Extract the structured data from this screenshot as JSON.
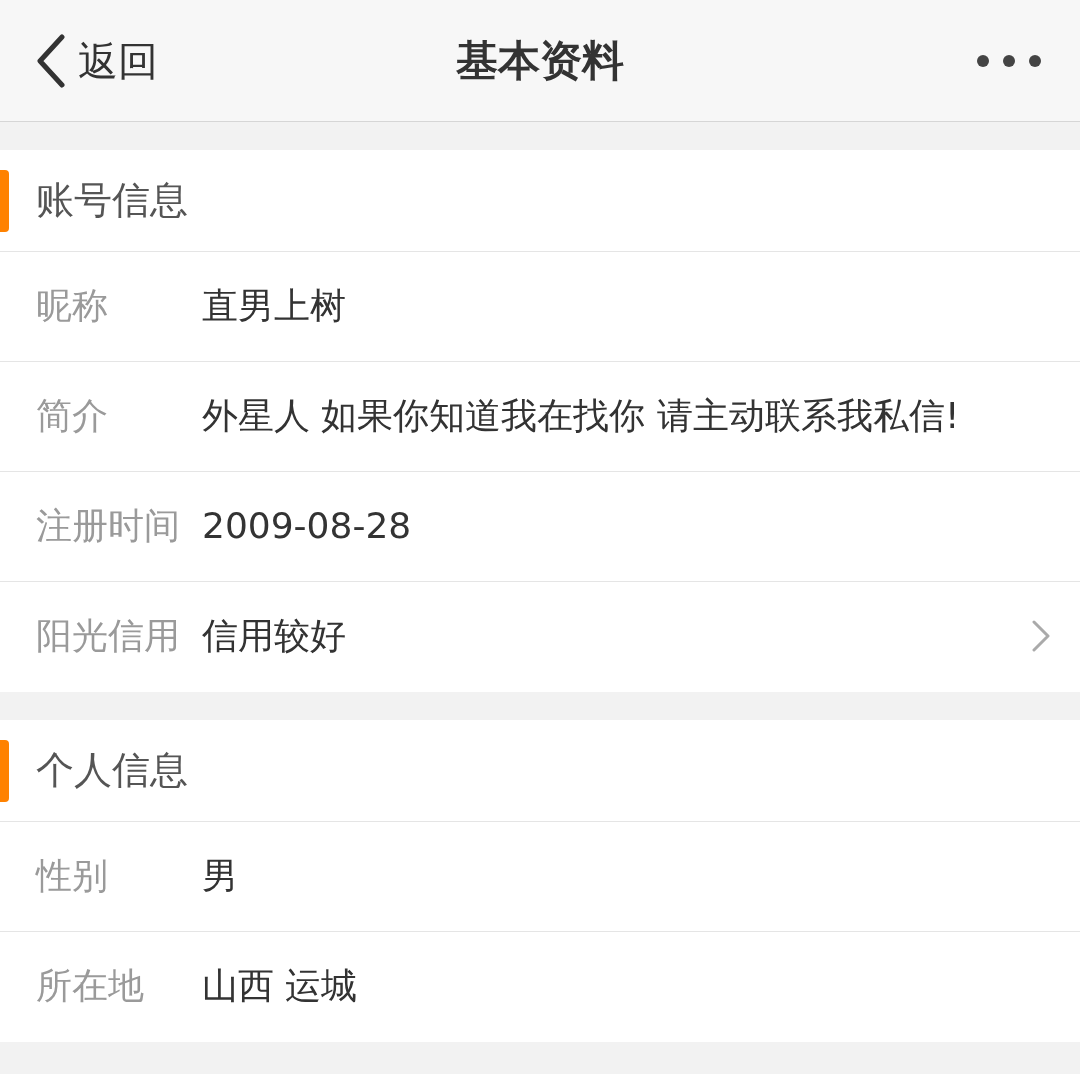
{
  "nav": {
    "back_label": "返回",
    "title": "基本资料"
  },
  "sections": [
    {
      "title": "账号信息",
      "rows": [
        {
          "label": "昵称",
          "value": "直男上树",
          "chevron": false
        },
        {
          "label": "简介",
          "value": "外星人 如果你知道我在找你 请主动联系我私信!",
          "chevron": false
        },
        {
          "label": "注册时间",
          "value": "2009-08-28",
          "chevron": false
        },
        {
          "label": "阳光信用",
          "value": "信用较好",
          "chevron": true
        }
      ]
    },
    {
      "title": "个人信息",
      "rows": [
        {
          "label": "性别",
          "value": "男",
          "chevron": false
        },
        {
          "label": "所在地",
          "value": "山西 运城",
          "chevron": false
        }
      ]
    }
  ]
}
